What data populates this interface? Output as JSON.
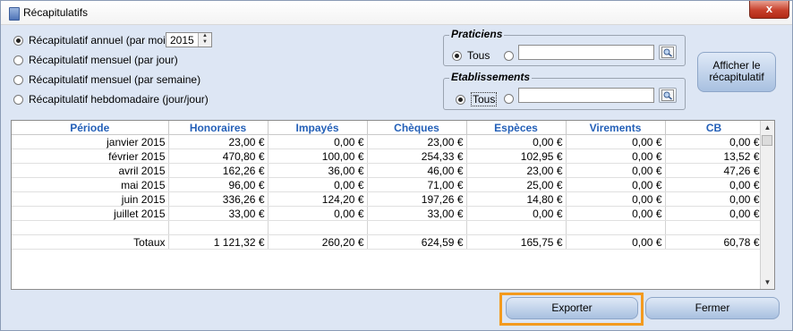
{
  "window": {
    "title": "Récapitulatifs",
    "close_label": "x"
  },
  "options": {
    "annual_label": "Récapitulatif annuel (par mois)",
    "monthly_day_label": "Récapitulatif mensuel (par jour)",
    "monthly_week_label": "Récapitulatif mensuel (par semaine)",
    "weekly_label": "Récapitulatif hebdomadaire (jour/jour)",
    "selected": "annual",
    "year_value": "2015"
  },
  "praticiens": {
    "title": "Praticiens",
    "all_label": "Tous",
    "selected": "all",
    "field_value": ""
  },
  "etablissements": {
    "title": "Etablissements",
    "all_label": "Tous",
    "selected": "all",
    "field_value": ""
  },
  "show_button_label": "Afficher le récapitulatif",
  "table": {
    "columns": [
      "Période",
      "Honoraires",
      "Impayés",
      "Chèques",
      "Espèces",
      "Virements",
      "CB"
    ],
    "rows": [
      [
        "janvier 2015",
        "23,00 €",
        "0,00 €",
        "23,00 €",
        "0,00 €",
        "0,00 €",
        "0,00 €"
      ],
      [
        "février 2015",
        "470,80 €",
        "100,00 €",
        "254,33 €",
        "102,95 €",
        "0,00 €",
        "13,52 €"
      ],
      [
        "avril 2015",
        "162,26 €",
        "36,00 €",
        "46,00 €",
        "23,00 €",
        "0,00 €",
        "47,26 €"
      ],
      [
        "mai 2015",
        "96,00 €",
        "0,00 €",
        "71,00 €",
        "25,00 €",
        "0,00 €",
        "0,00 €"
      ],
      [
        "juin 2015",
        "336,26 €",
        "124,20 €",
        "197,26 €",
        "14,80 €",
        "0,00 €",
        "0,00 €"
      ],
      [
        "juillet 2015",
        "33,00 €",
        "0,00 €",
        "33,00 €",
        "0,00 €",
        "0,00 €",
        "0,00 €"
      ],
      [
        "",
        "",
        "",
        "",
        "",
        "",
        ""
      ],
      [
        "Totaux",
        "1 121,32 €",
        "260,20 €",
        "624,59 €",
        "165,75 €",
        "0,00 €",
        "60,78 €"
      ]
    ]
  },
  "footer": {
    "export_label": "Exporter",
    "close_label": "Fermer"
  },
  "colors": {
    "header_text": "#2460b8",
    "highlight": "#f39a1e",
    "window_bg": "#dde6f4"
  }
}
